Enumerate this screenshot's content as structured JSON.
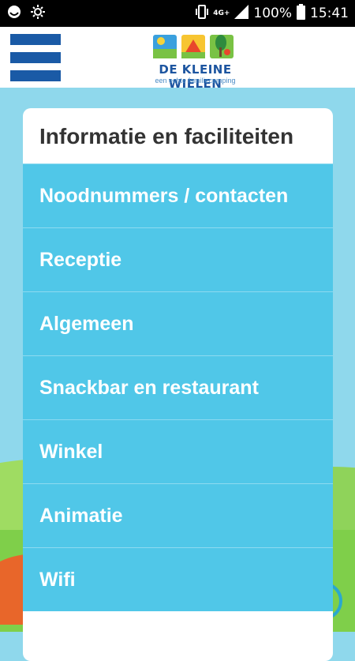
{
  "status_bar": {
    "network_label": "4G+",
    "battery_percent": "100%",
    "time": "15:41",
    "icons": [
      "notification-icon",
      "brightness-icon",
      "vibrate-icon",
      "signal-icon",
      "battery-icon"
    ]
  },
  "header": {
    "logo_title": "DE KLEINE WIELEN",
    "logo_subtitle": "een echte familiecamping"
  },
  "menu": {
    "title": "Informatie en faciliteiten",
    "items": [
      {
        "label": "Noodnummers / contacten"
      },
      {
        "label": "Receptie"
      },
      {
        "label": "Algemeen"
      },
      {
        "label": "Snackbar en restaurant"
      },
      {
        "label": "Winkel"
      },
      {
        "label": "Animatie"
      },
      {
        "label": "Wifi"
      }
    ]
  },
  "colors": {
    "brand_blue": "#1a5aa6",
    "item_blue": "#33bee4",
    "sky": "#8fd8ec",
    "grass": "#7fcf4a"
  }
}
